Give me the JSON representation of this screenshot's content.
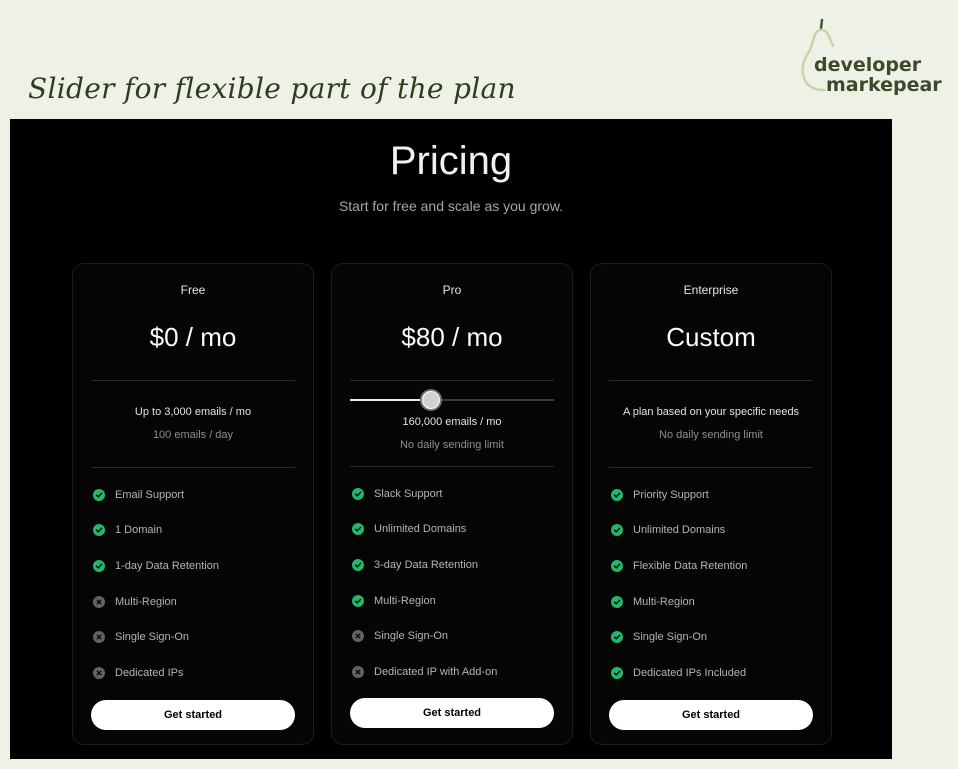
{
  "annotation": "Slider for flexible part of the plan",
  "brand": {
    "line1": "developer",
    "line2": "markepear"
  },
  "page": {
    "title": "Pricing",
    "subtitle": "Start for free and scale as you grow."
  },
  "plans": [
    {
      "name": "Free",
      "price": "$0 / mo",
      "quota": "Up to 3,000 emails / mo",
      "limit": "100 emails / day",
      "features": [
        {
          "label": "Email Support",
          "included": true
        },
        {
          "label": "1 Domain",
          "included": true
        },
        {
          "label": "1-day Data Retention",
          "included": true
        },
        {
          "label": "Multi-Region",
          "included": false
        },
        {
          "label": "Single Sign-On",
          "included": false
        },
        {
          "label": "Dedicated IPs",
          "included": false
        }
      ],
      "cta": "Get started"
    },
    {
      "name": "Pro",
      "price": "$80 / mo",
      "slider": {
        "value": 0.39
      },
      "quota": "160,000 emails / mo",
      "limit": "No daily sending limit",
      "features": [
        {
          "label": "Slack Support",
          "included": true
        },
        {
          "label": "Unlimited Domains",
          "included": true
        },
        {
          "label": "3-day Data Retention",
          "included": true
        },
        {
          "label": "Multi-Region",
          "included": true
        },
        {
          "label": "Single Sign-On",
          "included": false
        },
        {
          "label": "Dedicated IP with Add-on",
          "included": false
        }
      ],
      "cta": "Get started"
    },
    {
      "name": "Enterprise",
      "price": "Custom",
      "quota": "A plan based on your specific needs",
      "limit": "No daily sending limit",
      "features": [
        {
          "label": "Priority Support",
          "included": true
        },
        {
          "label": "Unlimited Domains",
          "included": true
        },
        {
          "label": "Flexible Data Retention",
          "included": true
        },
        {
          "label": "Multi-Region",
          "included": true
        },
        {
          "label": "Single Sign-On",
          "included": true
        },
        {
          "label": "Dedicated IPs Included",
          "included": true
        }
      ],
      "cta": "Get started"
    }
  ],
  "colors": {
    "included": "#22b86a",
    "excluded": "#636363",
    "panel": "#000000",
    "background": "#eef2e6"
  }
}
